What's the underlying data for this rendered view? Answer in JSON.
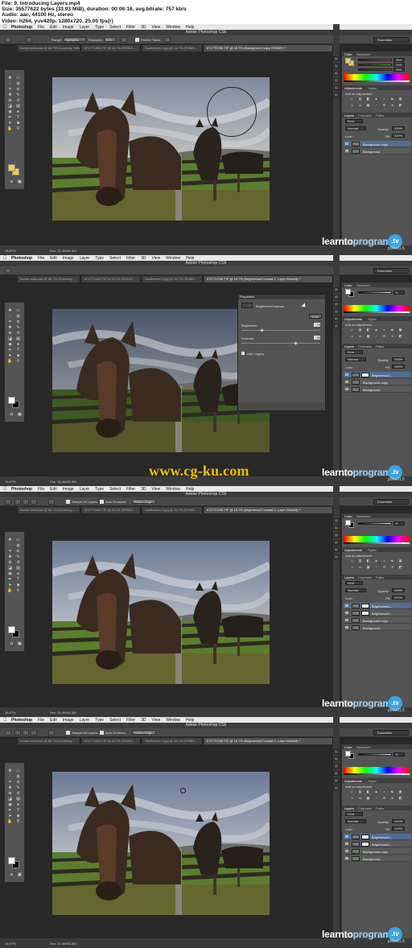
{
  "header": {
    "line1": "File: 9. Introducing Layers.mp4",
    "line2": "Size: 35577622 bytes (33.93 MiB), duration: 00:06:16, avg.bitrate: 757 kb/s",
    "line3": "Audio: aac, 44100 Hz, stereo",
    "line4": "Video: h264, yuv420p, 1280x720, 25.00 fps(r)"
  },
  "menubar": {
    "app": "Photoshop",
    "items": [
      "File",
      "Edit",
      "Image",
      "Layer",
      "Type",
      "Select",
      "Filter",
      "3D",
      "View",
      "Window",
      "Help"
    ]
  },
  "window_title": "Adobe Photoshop CS6",
  "essentials": "Essentials",
  "status_zoom": "16.67%",
  "status_doc": "Doc: 31.4M/62.8M",
  "watermark": {
    "brand_a": "learnto",
    "brand_b": "program",
    "tv": ".tv",
    "code": "p00e01.5"
  },
  "site_watermark": "www.cg-ku.com",
  "frames": [
    {
      "options": {
        "range_label": "Range:",
        "range": "Highlights",
        "exposure_label": "Exposure:",
        "exposure": "50%",
        "protect": "Protect Tones"
      },
      "tabs": [
        "horses dark.psd @ 66.7% (Courtesy: Wikitravel...",
        "6717T1044.TIF @ 16.7% (RGB/8...",
        "Sunflowers 2.jpg @ 16.7% (RGB/8...",
        "6717T0765.TIF @ 16.7% (Background copy, RGB/8*) *"
      ],
      "color_values": [
        "252",
        "245",
        "202"
      ],
      "adjustments_title": "Add an adjustment",
      "layer_kind": "Kind",
      "blend": "Normal",
      "opacity_label": "Opacity:",
      "opacity": "100%",
      "lock_label": "Lock:",
      "fill_label": "Fill:",
      "fill": "100%",
      "layers": [
        {
          "name": "Background copy",
          "selected": true
        },
        {
          "name": "Background",
          "selected": false
        }
      ]
    },
    {
      "tabs": [
        "horses dark.psd @ 66.7% (Courtesy:...",
        "6717T1044.TIF @ 16.7% (RGB/8...",
        "Sunflowers 2.jpg @ 16.7% (RGB/8...",
        "6717T0765.TIF @ 16.7% (Brightness/Contrast 1, Layer Mask/8) *"
      ],
      "properties": {
        "panel_title": "Properties",
        "adj_name": "Brightness/Contrast",
        "auto": "Auto",
        "brightness_label": "Brightness:",
        "brightness": "-78",
        "contrast_label": "Contrast:",
        "contrast": "29",
        "legacy": "Use Legacy"
      },
      "color_values": [
        "0"
      ],
      "adjustments_title": "Add an adjustment",
      "layer_kind": "Kind",
      "blend": "Normal",
      "opacity_label": "Opacity:",
      "opacity": "100%",
      "lock_label": "Lock:",
      "fill_label": "Fill:",
      "fill": "100%",
      "layers": [
        {
          "name": "Brightness/C...",
          "selected": true
        },
        {
          "name": "Background copy",
          "selected": false
        },
        {
          "name": "Background",
          "selected": false
        }
      ]
    },
    {
      "options": {
        "sample": "Sample All Layers",
        "enhance": "Auto-Enhance",
        "refine": "Refine Edge..."
      },
      "tabs": [
        "horses dark.psd @ 66.7% (Courtesy:...",
        "6717T1044.TIF @ 16.7% (RGB/8...",
        "Sunflowers 2.jpg @ 16.7% (RGB/8...",
        "6717T0765.TIF @ 16.7% (Brightness/Contrast 2, Layer Mask/8) *"
      ],
      "color_values": [
        "0"
      ],
      "adjustments_title": "Add an adjustment",
      "layer_kind": "Kind",
      "blend": "Normal",
      "opacity_label": "Opacity:",
      "opacity": "100%",
      "lock_label": "Lock:",
      "fill_label": "Fill:",
      "fill": "100%",
      "layers": [
        {
          "name": "Brightness/C...",
          "selected": true
        },
        {
          "name": "Brightness/C...",
          "selected": false
        },
        {
          "name": "Background copy",
          "selected": false
        },
        {
          "name": "Background",
          "selected": false
        }
      ]
    },
    {
      "options": {
        "sample": "Sample All Layers",
        "enhance": "Auto-Enhance",
        "refine": "Refine Edge..."
      },
      "tabs": [
        "horses dark.psd @ 66.7% (Courtesy:...",
        "6717T1044.TIF @ 16.7% (RGB/8...",
        "Sunflowers 2.jpg @ 16.7% (RGB/8...",
        "6717T0765.TIF @ 16.7% (Brightness/Contrast 2, Layer Mask/8) *"
      ],
      "color_values": [
        "0"
      ],
      "adjustments_title": "Add an adjustment",
      "layer_kind": "Kind",
      "blend": "Normal",
      "opacity_label": "Opacity:",
      "opacity": "100%",
      "lock_label": "Lock:",
      "fill_label": "Fill:",
      "fill": "100%",
      "layers": [
        {
          "name": "Brightness/C...",
          "selected": true
        },
        {
          "name": "Brightness/C...",
          "selected": false
        },
        {
          "name": "Background copy",
          "selected": false
        },
        {
          "name": "Background",
          "selected": false
        }
      ]
    }
  ]
}
